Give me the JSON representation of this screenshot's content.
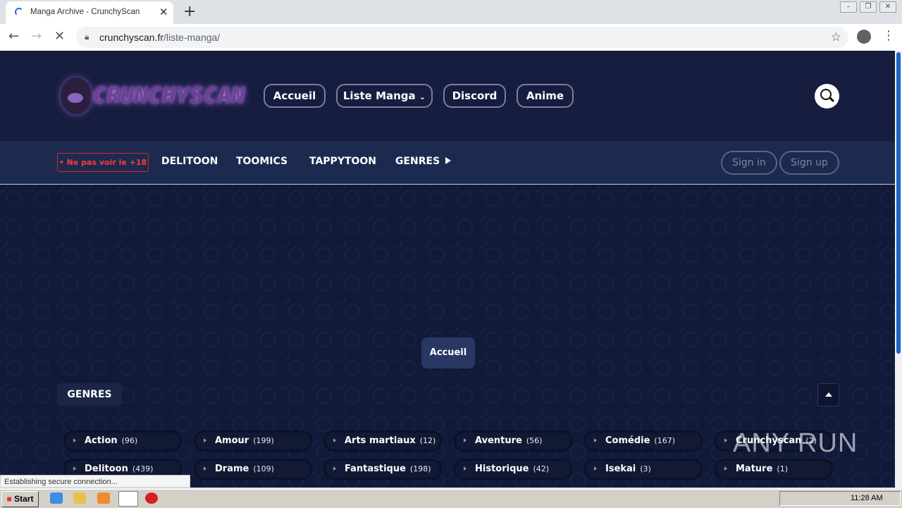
{
  "browser": {
    "tab_title": "Manga Archive - CrunchyScan",
    "url_host": "crunchyscan.fr",
    "url_path": "/liste-manga/",
    "status_text": "Establishing secure connection..."
  },
  "site": {
    "logo_text": "CRUNCHYSCAN",
    "nav": [
      "Accueil",
      "Liste Manga",
      "Discord",
      "Anime"
    ],
    "warning_label": "• Ne pas voir le +18",
    "subnav": [
      "DELITOON",
      "TOOMICS",
      "TAPPYTOON",
      "GENRES"
    ],
    "sign_in": "Sign in",
    "sign_up": "Sign up",
    "breadcrumb": "Accueil",
    "genres_title": "GENRES",
    "genres": [
      {
        "name": "Action",
        "count": "(96)"
      },
      {
        "name": "Amour",
        "count": "(199)"
      },
      {
        "name": "Arts martiaux",
        "count": "(12)"
      },
      {
        "name": "Aventure",
        "count": "(56)"
      },
      {
        "name": "Comédie",
        "count": "(167)"
      },
      {
        "name": "Crunchyscan",
        "count": "(2)"
      },
      {
        "name": "Delitoon",
        "count": "(439)"
      },
      {
        "name": "Drame",
        "count": "(109)"
      },
      {
        "name": "Fantastique",
        "count": "(198)"
      },
      {
        "name": "Historique",
        "count": "(42)"
      },
      {
        "name": "Isekai",
        "count": "(3)"
      },
      {
        "name": "Mature",
        "count": "(1)"
      }
    ]
  },
  "watermark": "ANY RUN",
  "taskbar": {
    "start_label": "Start",
    "clock": "11:28 AM"
  }
}
